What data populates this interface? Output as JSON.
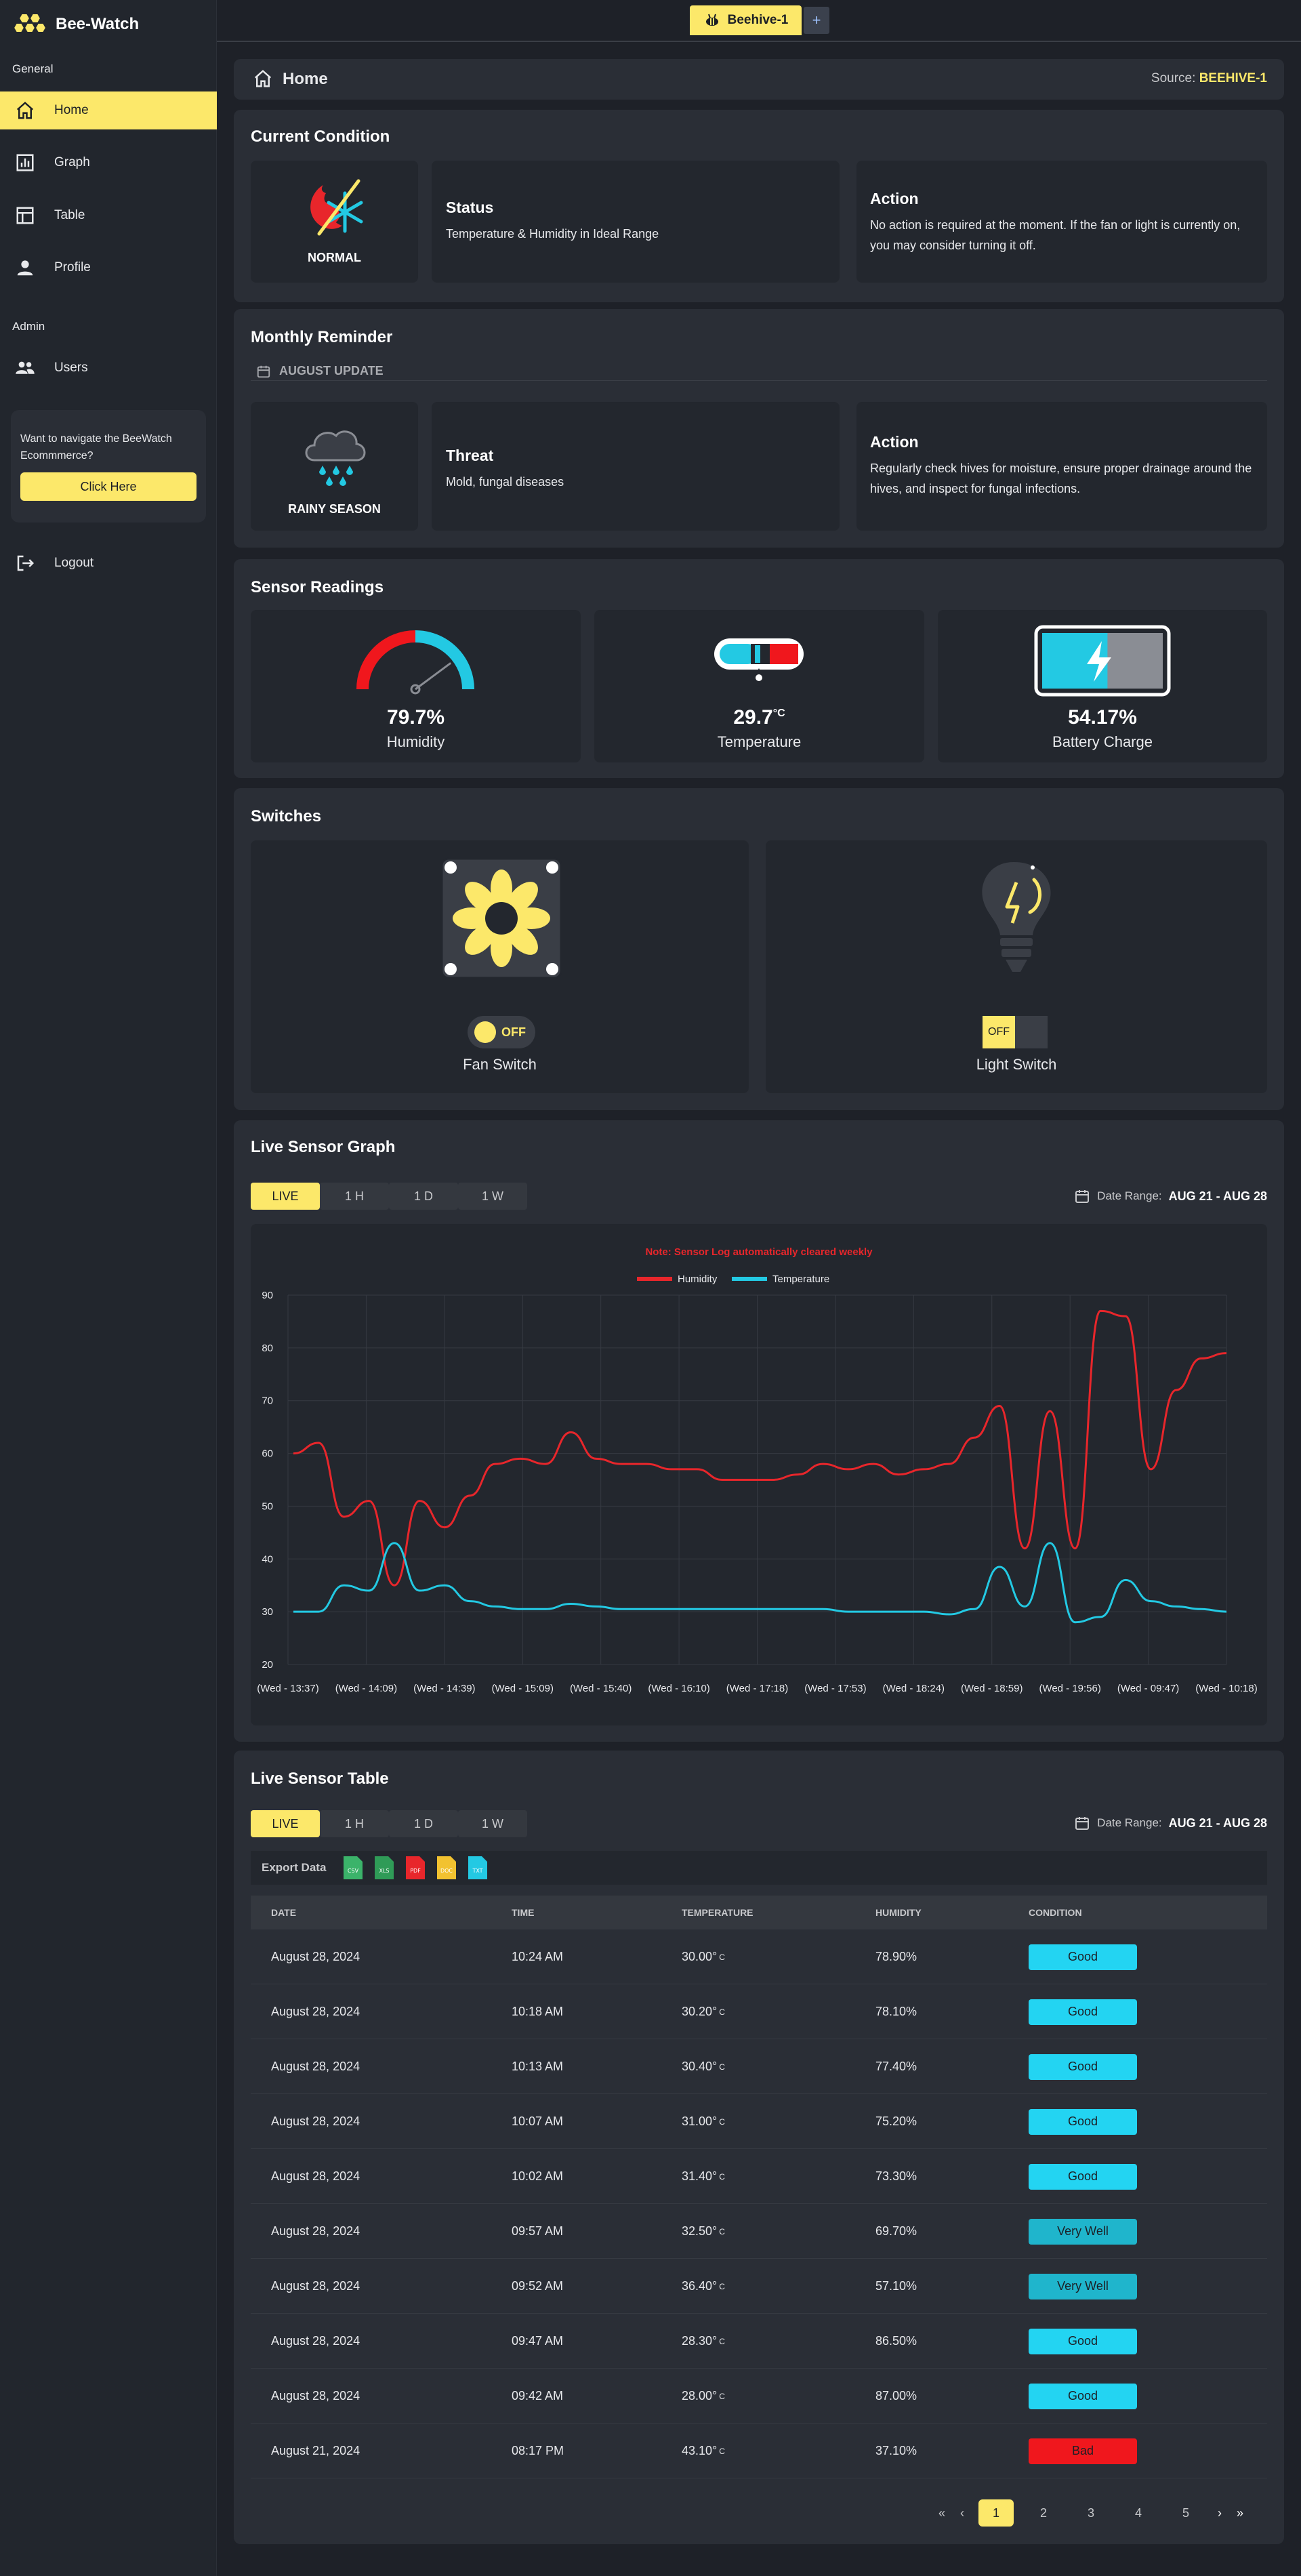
{
  "brand": {
    "name": "Bee-Watch"
  },
  "sidebar": {
    "section_general": "General",
    "section_admin": "Admin",
    "items": [
      {
        "label": "Home",
        "icon": "home-icon"
      },
      {
        "label": "Graph",
        "icon": "bar-chart-icon"
      },
      {
        "label": "Table",
        "icon": "table-icon"
      },
      {
        "label": "Profile",
        "icon": "user-icon"
      },
      {
        "label": "Users",
        "icon": "users-icon"
      }
    ],
    "promo_text": "Want to navigate the BeeWatch Ecommmerce?",
    "promo_button": "Click Here",
    "logout": "Logout"
  },
  "topbar": {
    "tab_label": "Beehive-1",
    "add_label": "+"
  },
  "header": {
    "title": "Home",
    "source_label": "Source:",
    "source_value": "BEEHIVE-1"
  },
  "condition": {
    "title": "Current Condition",
    "icon_label": "NORMAL",
    "status_title": "Status",
    "status_text": "Temperature & Humidity in Ideal Range",
    "action_title": "Action",
    "action_text": "No action is required at the moment. If the fan or light is currently on, you may consider turning it off."
  },
  "reminder": {
    "title": "Monthly Reminder",
    "update_label": "AUGUST UPDATE",
    "icon_label": "RAINY SEASON",
    "threat_title": "Threat",
    "threat_text": "Mold, fungal diseases",
    "action_title": "Action",
    "action_text": "Regularly check hives for moisture, ensure proper drainage around the hives, and inspect for fungal infections."
  },
  "sensors": {
    "title": "Sensor Readings",
    "humidity_value": "79.7%",
    "humidity_label": "Humidity",
    "temperature_value": "29.7",
    "temperature_unit": "°C",
    "temperature_label": "Temperature",
    "battery_value": "54.17%",
    "battery_label": "Battery Charge",
    "humidity_fraction": 0.797,
    "battery_fraction": 0.5417
  },
  "switches": {
    "title": "Switches",
    "fan_state": "OFF",
    "fan_label": "Fan Switch",
    "light_state": "OFF",
    "light_label": "Light Switch"
  },
  "graph": {
    "title": "Live Sensor Graph",
    "ranges": [
      "LIVE",
      "1 H",
      "1 D",
      "1 W"
    ],
    "active_range": "LIVE",
    "date_label": "Date Range:",
    "date_value": "AUG 21 - AUG 28",
    "note": "Note: Sensor Log automatically cleared weekly"
  },
  "chart_data": {
    "type": "line",
    "x": [
      "(Wed - 13:37)",
      "(Wed - 14:09)",
      "(Wed - 14:39)",
      "(Wed - 15:09)",
      "(Wed - 15:40)",
      "(Wed - 16:10)",
      "(Wed - 17:18)",
      "(Wed - 17:53)",
      "(Wed - 18:24)",
      "(Wed - 18:59)",
      "(Wed - 19:56)",
      "(Wed - 09:47)",
      "(Wed - 10:18)"
    ],
    "ylim": [
      20,
      90
    ],
    "yticks": [
      20,
      30,
      40,
      50,
      60,
      70,
      80,
      90
    ],
    "grid": true,
    "legend": "top",
    "series": [
      {
        "name": "Humidity",
        "color": "#e8262b",
        "values": [
          60,
          62,
          48,
          51,
          35,
          51,
          46,
          52,
          58,
          59,
          58,
          64,
          59,
          58,
          58,
          57,
          57,
          55,
          55,
          55,
          56,
          58,
          57,
          58,
          56,
          57,
          58,
          63,
          69,
          42,
          68,
          42,
          87,
          86,
          57,
          72,
          78,
          79
        ]
      },
      {
        "name": "Temperature",
        "color": "#23c9e3",
        "values": [
          30,
          30,
          35,
          34,
          43,
          34,
          35,
          32,
          31,
          30.5,
          30.5,
          31.5,
          31,
          30.5,
          30.5,
          30.5,
          30.5,
          30.5,
          30.5,
          30.5,
          30.5,
          30.5,
          30,
          30,
          30,
          30,
          29.5,
          30.5,
          38.5,
          31,
          43,
          28,
          29,
          36,
          32,
          31,
          30.5,
          30
        ]
      }
    ]
  },
  "table": {
    "title": "Live Sensor Table",
    "ranges": [
      "LIVE",
      "1 H",
      "1 D",
      "1 W"
    ],
    "active_range": "LIVE",
    "date_label": "Date Range:",
    "date_value": "AUG 21 - AUG 28",
    "export_label": "Export Data",
    "export_formats": [
      "CSV",
      "XLS",
      "PDF",
      "DOC",
      "TXT"
    ],
    "columns": [
      "DATE",
      "TIME",
      "TEMPERATURE",
      "HUMIDITY",
      "CONDITION"
    ],
    "rows": [
      {
        "date": "August 28, 2024",
        "time": "10:24 AM",
        "temp": "30.00°",
        "unit": "C",
        "humidity": "78.90%",
        "condition": "Good",
        "color": "#23d4f2"
      },
      {
        "date": "August 28, 2024",
        "time": "10:18 AM",
        "temp": "30.20°",
        "unit": "C",
        "humidity": "78.10%",
        "condition": "Good",
        "color": "#23d4f2"
      },
      {
        "date": "August 28, 2024",
        "time": "10:13 AM",
        "temp": "30.40°",
        "unit": "C",
        "humidity": "77.40%",
        "condition": "Good",
        "color": "#23d4f2"
      },
      {
        "date": "August 28, 2024",
        "time": "10:07 AM",
        "temp": "31.00°",
        "unit": "C",
        "humidity": "75.20%",
        "condition": "Good",
        "color": "#23d4f2"
      },
      {
        "date": "August 28, 2024",
        "time": "10:02 AM",
        "temp": "31.40°",
        "unit": "C",
        "humidity": "73.30%",
        "condition": "Good",
        "color": "#23d4f2"
      },
      {
        "date": "August 28, 2024",
        "time": "09:57 AM",
        "temp": "32.50°",
        "unit": "C",
        "humidity": "69.70%",
        "condition": "Very Well",
        "color": "#1fb5cc"
      },
      {
        "date": "August 28, 2024",
        "time": "09:52 AM",
        "temp": "36.40°",
        "unit": "C",
        "humidity": "57.10%",
        "condition": "Very Well",
        "color": "#1fb5cc"
      },
      {
        "date": "August 28, 2024",
        "time": "09:47 AM",
        "temp": "28.30°",
        "unit": "C",
        "humidity": "86.50%",
        "condition": "Good",
        "color": "#23d4f2"
      },
      {
        "date": "August 28, 2024",
        "time": "09:42 AM",
        "temp": "28.00°",
        "unit": "C",
        "humidity": "87.00%",
        "condition": "Good",
        "color": "#23d4f2"
      },
      {
        "date": "August 21, 2024",
        "time": "08:17 PM",
        "temp": "43.10°",
        "unit": "C",
        "humidity": "37.10%",
        "condition": "Bad",
        "color": "#f0171d"
      }
    ],
    "pagination": {
      "first": "«",
      "prev": "‹",
      "pages": [
        "1",
        "2",
        "3",
        "4",
        "5"
      ],
      "active": "1",
      "next": "›",
      "last": "»"
    }
  }
}
